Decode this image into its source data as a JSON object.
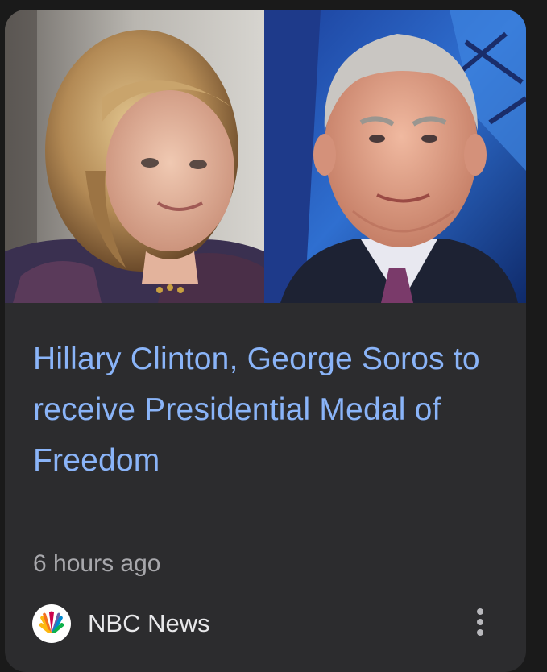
{
  "card": {
    "headline": "Hillary Clinton, George Soros to receive Presidential Medal of Freedom",
    "time_ago": "6 hours ago",
    "source": {
      "name": "NBC News",
      "logo_icon": "nbc-peacock-icon"
    },
    "more_icon": "more-vertical-icon",
    "thumbnail": {
      "left_photo": "hillary-clinton-portrait",
      "right_photo": "george-soros-portrait"
    }
  },
  "colors": {
    "card_background": "#2c2c2e",
    "headline": "#8ab4f8",
    "meta_text": "#a8a8ac",
    "source_text": "#e8e8ea"
  }
}
